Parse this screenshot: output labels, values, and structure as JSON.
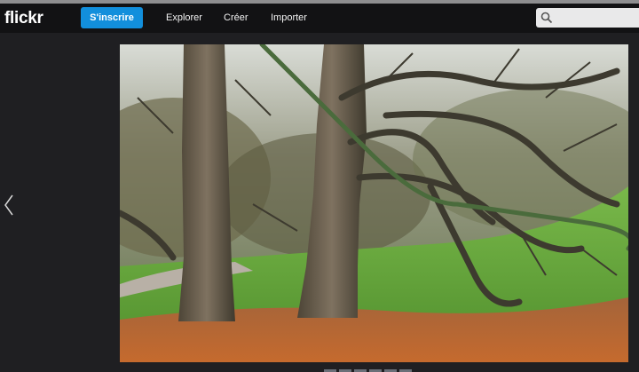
{
  "brand": {
    "logo_text": "flickr"
  },
  "nav": {
    "signup_label": "S'inscrire",
    "links": [
      "Explorer",
      "Créer",
      "Importer"
    ],
    "search_placeholder": ""
  },
  "colors": {
    "accent": "#128fdc",
    "navbar": "#121214",
    "background": "#1f1f22"
  },
  "photo": {
    "subject": "Trees in a park with autumn leaves"
  },
  "lightbox": {
    "thumbnails_count": 6
  }
}
